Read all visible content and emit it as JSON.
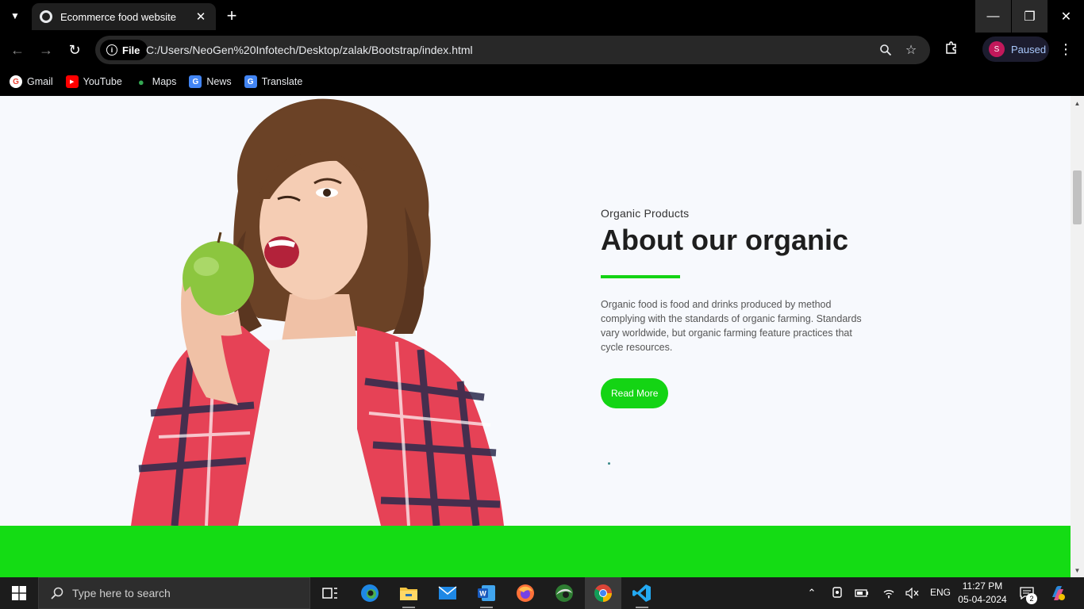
{
  "browser": {
    "tab_title": "Ecommerce food website",
    "url_chip": "File",
    "url": "C:/Users/NeoGen%20Infotech/Desktop/zalak/Bootstrap/index.html",
    "profile_label": "Paused",
    "profile_initial": "S",
    "bookmarks": [
      {
        "label": "Gmail",
        "icon": "gmail-icon",
        "color": "#ea4335"
      },
      {
        "label": "YouTube",
        "icon": "youtube-icon",
        "color": "#ff0000"
      },
      {
        "label": "Maps",
        "icon": "maps-icon",
        "color": "#34a853"
      },
      {
        "label": "News",
        "icon": "news-icon",
        "color": "#4285f4"
      },
      {
        "label": "Translate",
        "icon": "translate-icon",
        "color": "#4285f4"
      }
    ]
  },
  "page": {
    "eyebrow": "Organic Products",
    "heading": "About our organic",
    "body": "Organic food is food and drinks produced by method complying with the standards of organic farming. Standards vary worldwide, but organic farming feature practices that cycle resources.",
    "cta_label": "Read More",
    "accent_color": "#14d414"
  },
  "taskbar": {
    "search_placeholder": "Type here to search",
    "language": "ENG",
    "time": "11:27 PM",
    "date": "05-04-2024",
    "notification_count": "2"
  }
}
